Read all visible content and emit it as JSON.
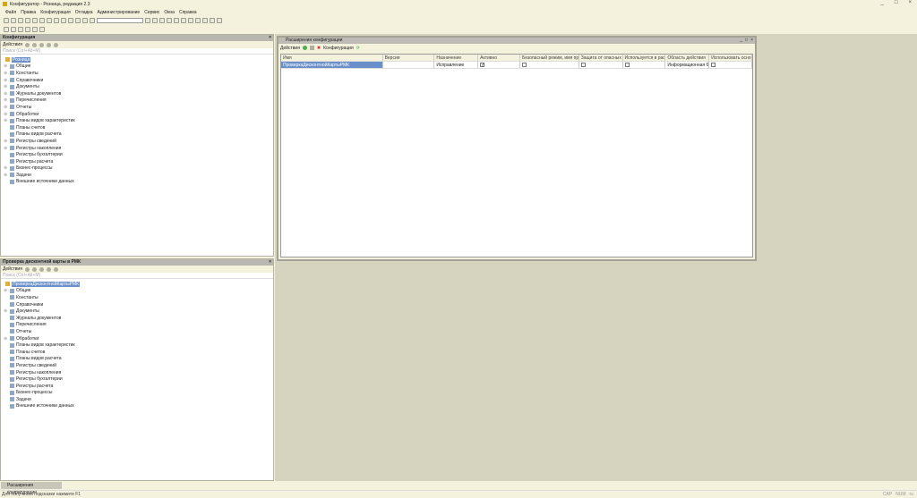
{
  "window": {
    "title": "Конфигуратор - Розница, редакция 2.3",
    "controls": [
      "_",
      "□",
      "×"
    ]
  },
  "menu": [
    "Файл",
    "Правка",
    "Конфигурация",
    "Отладка",
    "Администрирование",
    "Сервис",
    "Окна",
    "Справка"
  ],
  "config_panel": {
    "title": "Конфигурация",
    "actions": "Действия",
    "search_placeholder": "Поиск (Ctrl+Alt+M)",
    "root": "Розница",
    "items": [
      {
        "label": "Общие",
        "exp": true
      },
      {
        "label": "Константы",
        "exp": true
      },
      {
        "label": "Справочники",
        "exp": true
      },
      {
        "label": "Документы",
        "exp": true
      },
      {
        "label": "Журналы документов",
        "exp": true
      },
      {
        "label": "Перечисления",
        "exp": true
      },
      {
        "label": "Отчеты",
        "exp": true
      },
      {
        "label": "Обработки",
        "exp": true
      },
      {
        "label": "Планы видов характеристик",
        "exp": true
      },
      {
        "label": "Планы счетов",
        "exp": false
      },
      {
        "label": "Планы видов расчета",
        "exp": false
      },
      {
        "label": "Регистры сведений",
        "exp": true
      },
      {
        "label": "Регистры накопления",
        "exp": true
      },
      {
        "label": "Регистры бухгалтерии",
        "exp": false
      },
      {
        "label": "Регистры расчета",
        "exp": false
      },
      {
        "label": "Бизнес-процессы",
        "exp": true
      },
      {
        "label": "Задачи",
        "exp": true
      },
      {
        "label": "Внешние источники данных",
        "exp": false
      }
    ]
  },
  "ext_panel": {
    "title": "Проверка дисконтной карты в РМК",
    "actions": "Действия",
    "search_placeholder": "Поиск (Ctrl+Alt+M)",
    "root": "ПроверкаДисконтнойКартыРМК",
    "items": [
      {
        "label": "Общие",
        "exp": true
      },
      {
        "label": "Константы",
        "exp": false
      },
      {
        "label": "Справочники",
        "exp": false
      },
      {
        "label": "Документы",
        "exp": true
      },
      {
        "label": "Журналы документов",
        "exp": false
      },
      {
        "label": "Перечисления",
        "exp": false
      },
      {
        "label": "Отчеты",
        "exp": false
      },
      {
        "label": "Обработки",
        "exp": true
      },
      {
        "label": "Планы видов характеристик",
        "exp": false
      },
      {
        "label": "Планы счетов",
        "exp": false
      },
      {
        "label": "Планы видов расчета",
        "exp": false
      },
      {
        "label": "Регистры сведений",
        "exp": false
      },
      {
        "label": "Регистры накопления",
        "exp": false
      },
      {
        "label": "Регистры бухгалтерии",
        "exp": false
      },
      {
        "label": "Регистры расчета",
        "exp": false
      },
      {
        "label": "Бизнес-процессы",
        "exp": false
      },
      {
        "label": "Задачи",
        "exp": false
      },
      {
        "label": "Внешние источники данных",
        "exp": false
      }
    ]
  },
  "extensions_window": {
    "title": "Расширения конфигурации",
    "actions": "Действия",
    "configuration": "Конфигурация",
    "columns": [
      "Имя",
      "Версия",
      "Назначение",
      "Активно",
      "Безопасный режим, имя про...",
      "Защита от опасных ...",
      "Используется в рас...",
      "Область действия",
      "Использовать основ..."
    ],
    "rows": [
      {
        "name": "ПроверкаДисконтнойКартыРМК",
        "version": "",
        "purpose": "Исправление",
        "active": true,
        "safe_mode": false,
        "protection": false,
        "used_in_distr": false,
        "scope": "Информационная ба...",
        "use_main": false
      }
    ]
  },
  "taskbar": {
    "tab": "Расширения конфигурации"
  },
  "status": {
    "hint": "Для получения подсказки нажмите F1",
    "indicators": [
      "CAP",
      "NUM",
      "ru"
    ]
  }
}
